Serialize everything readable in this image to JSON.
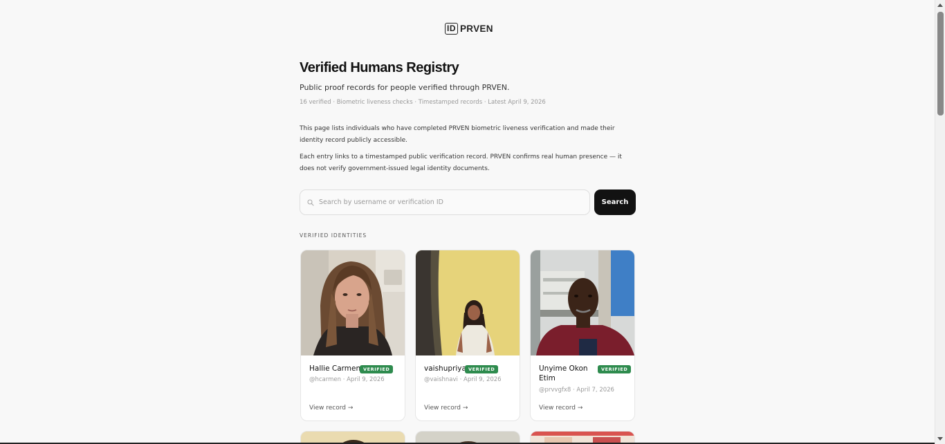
{
  "brand": {
    "mark": "ID",
    "name": "PRVEN"
  },
  "header": {
    "title": "Verified Humans Registry",
    "subtitle": "Public proof records for people verified through PRVEN.",
    "meta": "16 verified · Biometric liveness checks · Timestamped records · Latest April 9, 2026"
  },
  "description": {
    "p1": "This page lists individuals who have completed PRVEN biometric liveness verification and made their identity record publicly accessible.",
    "p2": "Each entry links to a timestamped public verification record. PRVEN confirms real human presence — it does not verify government-issued legal identity documents."
  },
  "search": {
    "placeholder": "Search by username or verification ID",
    "value": "",
    "button_label": "Search"
  },
  "section": {
    "label": "VERIFIED IDENTITIES"
  },
  "cards": [
    {
      "name": "Hallie Carmen",
      "badge": "VERIFIED",
      "meta": "@hcarmen · April 9, 2026",
      "link": "View record →"
    },
    {
      "name": "vaishupriya",
      "badge": "VERIFIED",
      "meta": "@vaishnavi · April 9, 2026",
      "link": "View record →"
    },
    {
      "name": "Unyime Okon Etim",
      "badge": "VERIFIED",
      "meta": "@prvvgfx8 · April 7, 2026",
      "link": "View record →"
    }
  ],
  "colors": {
    "accent": "#121212",
    "verified": "#2e8b4e",
    "background": "#f8f8f8"
  }
}
